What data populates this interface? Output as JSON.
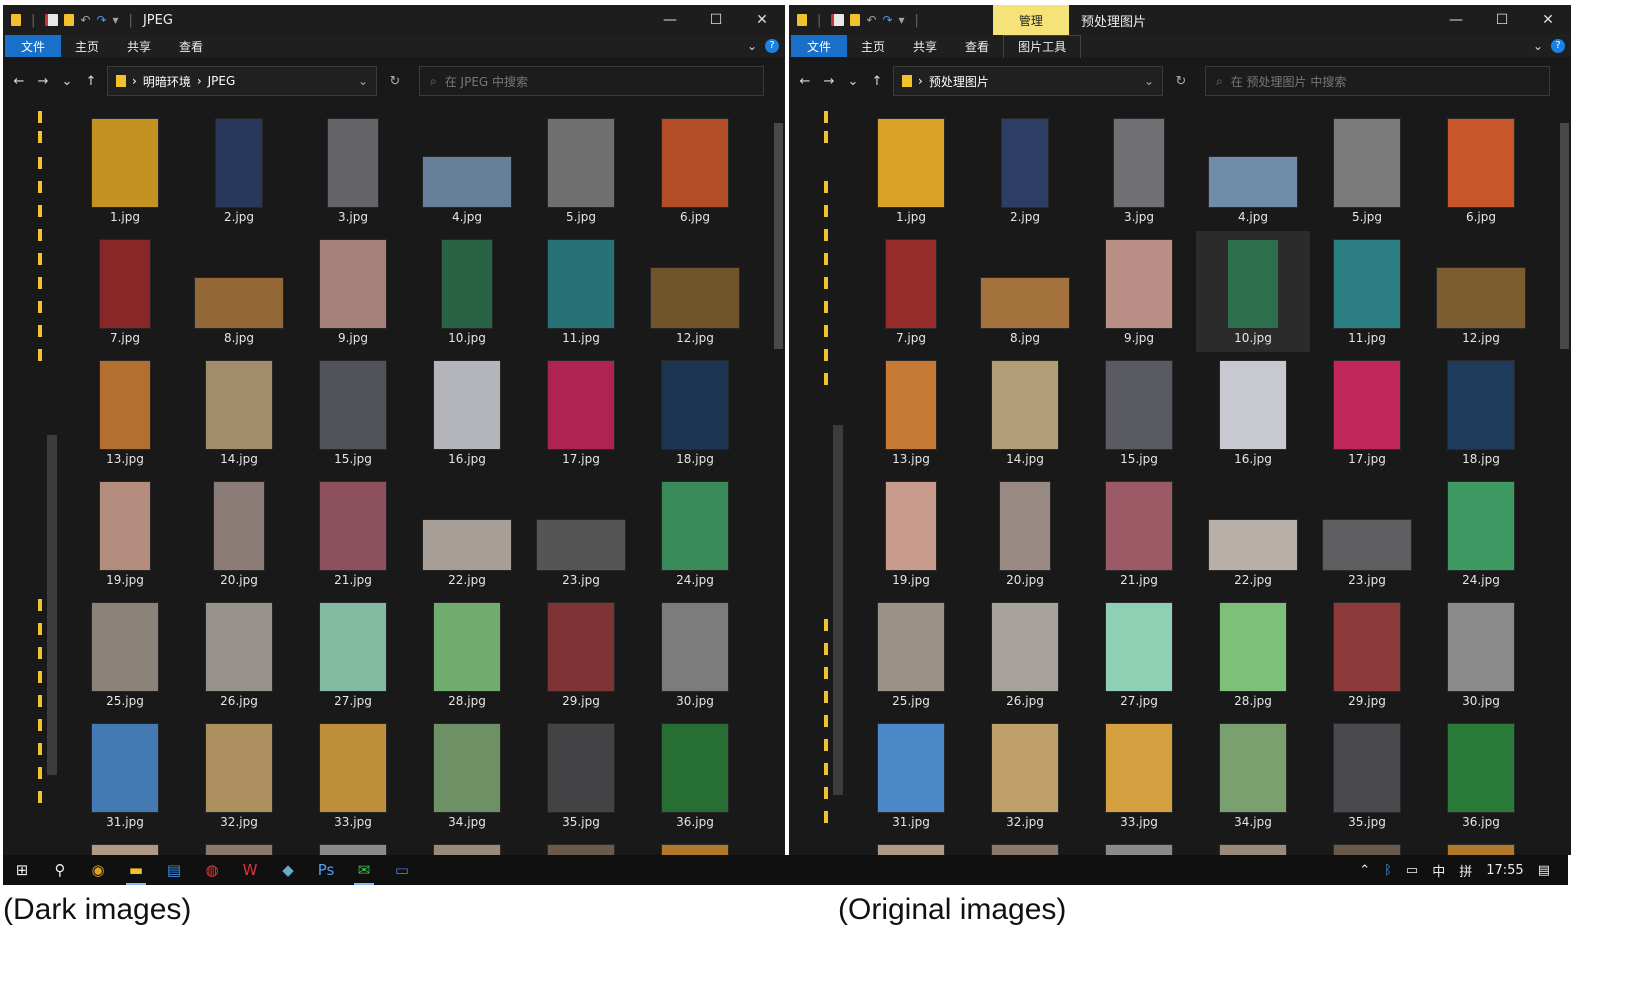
{
  "left": {
    "title": "JPEG",
    "tabs": [
      "文件",
      "主页",
      "共享",
      "查看"
    ],
    "breadcrumb": [
      "明暗环境",
      "JPEG"
    ],
    "search_placeholder": "在 JPEG 中搜索"
  },
  "right": {
    "manage_tab": "管理",
    "title": "预处理图片",
    "tabs": [
      "文件",
      "主页",
      "共享",
      "查看",
      "图片工具"
    ],
    "breadcrumb": [
      "预处理图片"
    ],
    "search_placeholder": "在 预处理图片 中搜索"
  },
  "window_controls": {
    "minimize": "—",
    "maximize": "☐",
    "close": "✕"
  },
  "files": [
    {
      "name": "1.jpg",
      "color": "#d9a227",
      "w": 66,
      "h": 88
    },
    {
      "name": "2.jpg",
      "color": "#2c3e64",
      "w": 46,
      "h": 88
    },
    {
      "name": "3.jpg",
      "color": "#6f6f74",
      "w": 50,
      "h": 88
    },
    {
      "name": "4.jpg",
      "color": "#6f8da8",
      "w": 88,
      "h": 50
    },
    {
      "name": "5.jpg",
      "color": "#7b7b7b",
      "w": 66,
      "h": 88
    },
    {
      "name": "6.jpg",
      "color": "#c7562b",
      "w": 66,
      "h": 88
    },
    {
      "name": "7.jpg",
      "color": "#962b2b",
      "w": 50,
      "h": 88
    },
    {
      "name": "8.jpg",
      "color": "#a4723c",
      "w": 88,
      "h": 50
    },
    {
      "name": "9.jpg",
      "color": "#b98f86",
      "w": 66,
      "h": 88
    },
    {
      "name": "10.jpg",
      "color": "#2d6e4d",
      "w": 50,
      "h": 88
    },
    {
      "name": "11.jpg",
      "color": "#2b7f83",
      "w": 66,
      "h": 88
    },
    {
      "name": "12.jpg",
      "color": "#7c5d2f",
      "w": 88,
      "h": 60
    },
    {
      "name": "13.jpg",
      "color": "#c77a35",
      "w": 50,
      "h": 88
    },
    {
      "name": "14.jpg",
      "color": "#b39d76",
      "w": 66,
      "h": 88
    },
    {
      "name": "15.jpg",
      "color": "#5a5a62",
      "w": 66,
      "h": 88
    },
    {
      "name": "16.jpg",
      "color": "#c8c8d0",
      "w": 66,
      "h": 88
    },
    {
      "name": "17.jpg",
      "color": "#c2275c",
      "w": 66,
      "h": 88
    },
    {
      "name": "18.jpg",
      "color": "#1f3b5c",
      "w": 66,
      "h": 88
    },
    {
      "name": "19.jpg",
      "color": "#c89b8c",
      "w": 50,
      "h": 88
    },
    {
      "name": "20.jpg",
      "color": "#9a8a84",
      "w": 50,
      "h": 88
    },
    {
      "name": "21.jpg",
      "color": "#9c5a66",
      "w": 66,
      "h": 88
    },
    {
      "name": "22.jpg",
      "color": "#b8b0a8",
      "w": 88,
      "h": 50
    },
    {
      "name": "23.jpg",
      "color": "#5e5e60",
      "w": 88,
      "h": 50
    },
    {
      "name": "24.jpg",
      "color": "#3e9a62",
      "w": 66,
      "h": 88
    },
    {
      "name": "25.jpg",
      "color": "#9a9286",
      "w": 66,
      "h": 88
    },
    {
      "name": "26.jpg",
      "color": "#a8a29c",
      "w": 66,
      "h": 88
    },
    {
      "name": "27.jpg",
      "color": "#8fd0b4",
      "w": 66,
      "h": 88
    },
    {
      "name": "28.jpg",
      "color": "#7cc07a",
      "w": 66,
      "h": 88
    },
    {
      "name": "29.jpg",
      "color": "#8c3a3a",
      "w": 66,
      "h": 88
    },
    {
      "name": "30.jpg",
      "color": "#8a8a8a",
      "w": 66,
      "h": 88
    },
    {
      "name": "31.jpg",
      "color": "#4a88c8",
      "w": 66,
      "h": 88
    },
    {
      "name": "32.jpg",
      "color": "#c0a06a",
      "w": 66,
      "h": 88
    },
    {
      "name": "33.jpg",
      "color": "#d4a040",
      "w": 66,
      "h": 88
    },
    {
      "name": "34.jpg",
      "color": "#7aa070",
      "w": 66,
      "h": 88
    },
    {
      "name": "35.jpg",
      "color": "#4a4a4e",
      "w": 66,
      "h": 88
    },
    {
      "name": "36.jpg",
      "color": "#2a7a3a",
      "w": 66,
      "h": 88
    }
  ],
  "partial_row_colors": [
    "#b09a86",
    "#8a7868",
    "#8a8a8a",
    "#9a8a7a",
    "#6a5a4a",
    "#b07a2a"
  ],
  "taskbar": {
    "time": "17:55",
    "ime": "中",
    "ime2": "拼"
  },
  "captions": {
    "left": "(Dark images)",
    "right": "(Original images)"
  },
  "colors": {
    "file_tab": "#1a6fc9",
    "manage_tab": "#f5e37a",
    "folder": "#f2c12e"
  }
}
